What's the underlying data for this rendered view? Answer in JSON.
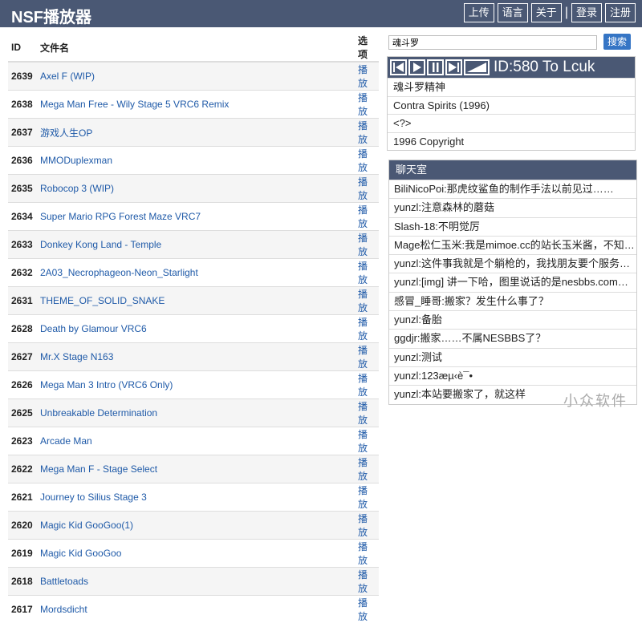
{
  "app": {
    "title": "NSF播放器"
  },
  "nav": [
    "上传",
    "语言",
    "关于",
    "登录",
    "注册"
  ],
  "nav_separator": "|",
  "table": {
    "headers": {
      "id": "ID",
      "name": "文件名",
      "action": "选项"
    },
    "rows": [
      {
        "id": "2639",
        "name": "Axel F (WIP)",
        "action": "播放"
      },
      {
        "id": "2638",
        "name": "Mega Man Free - Wily Stage 5 VRC6 Remix",
        "action": "播放"
      },
      {
        "id": "2637",
        "name": "游戏人生OP",
        "action": "播放"
      },
      {
        "id": "2636",
        "name": "MMODuplexman",
        "action": "播放"
      },
      {
        "id": "2635",
        "name": "Robocop 3 (WIP)",
        "action": "播放"
      },
      {
        "id": "2634",
        "name": "Super Mario RPG Forest Maze VRC7",
        "action": "播放"
      },
      {
        "id": "2633",
        "name": "Donkey Kong Land - Temple",
        "action": "播放"
      },
      {
        "id": "2632",
        "name": "2A03_Necrophageon-Neon_Starlight",
        "action": "播放"
      },
      {
        "id": "2631",
        "name": "THEME_OF_SOLID_SNAKE",
        "action": "播放"
      },
      {
        "id": "2628",
        "name": "Death by Glamour VRC6",
        "action": "播放"
      },
      {
        "id": "2627",
        "name": "Mr.X Stage N163",
        "action": "播放"
      },
      {
        "id": "2626",
        "name": "Mega Man 3 Intro (VRC6 Only)",
        "action": "播放"
      },
      {
        "id": "2625",
        "name": "Unbreakable Determination",
        "action": "播放"
      },
      {
        "id": "2623",
        "name": "Arcade Man",
        "action": "播放"
      },
      {
        "id": "2622",
        "name": "Mega Man F - Stage Select",
        "action": "播放"
      },
      {
        "id": "2621",
        "name": "Journey to Silius Stage 3",
        "action": "播放"
      },
      {
        "id": "2620",
        "name": "Magic Kid GooGoo(1)",
        "action": "播放"
      },
      {
        "id": "2619",
        "name": "Magic Kid GooGoo",
        "action": "播放"
      },
      {
        "id": "2618",
        "name": "Battletoads",
        "action": "播放"
      },
      {
        "id": "2617",
        "name": "Mordsdicht",
        "action": "播放"
      }
    ]
  },
  "search": {
    "value": "魂斗罗",
    "button": "搜索"
  },
  "player": {
    "title": "ID:580 To Lcuk",
    "lines": [
      "魂斗罗精神",
      "Contra Spirits (1996)",
      "<?>",
      "1996 Copyright"
    ]
  },
  "chat": {
    "title": "聊天室",
    "messages": [
      "BiliNicoPoi:那虎纹鲨鱼的制作手法以前见过……",
      "yunzl:注意森林的蘑菇",
      "Slash-18:不明觉厉",
      "Mage松仁玉米:我是mimoe.cc的站长玉米酱，不知…",
      "yunzl:这件事我就是个躺枪的，我找朋友要个服务…",
      "yunzl:[img] 讲一下哈，图里说话的是nesbbs.com…",
      "感冒_睡哥:搬家？发生什么事了？",
      "yunzl:备胎",
      "ggdjr:搬家……不属NESBBS了？",
      "yunzl:测试",
      "yunzl:123æµ‹è¯•",
      "yunzl:本站要搬家了，就这样"
    ]
  },
  "watermark": "小众软件",
  "colors": {
    "header_bg": "#4a5874",
    "link": "#1f5aa8",
    "search_btn": "#3575c5"
  }
}
